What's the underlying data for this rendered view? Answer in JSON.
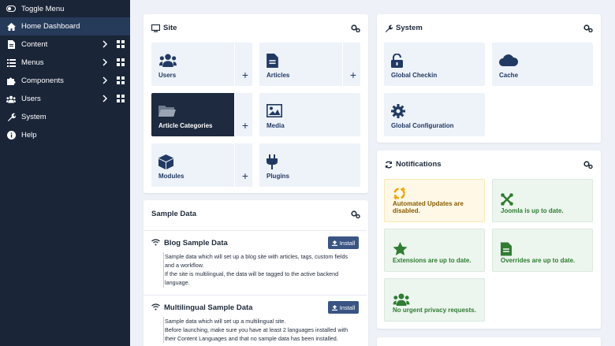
{
  "sidebar": {
    "toggle": "Toggle Menu",
    "items": [
      {
        "label": "Home Dashboard",
        "icon": "home-icon"
      },
      {
        "label": "Content",
        "icon": "file-icon"
      },
      {
        "label": "Menus",
        "icon": "list-icon"
      },
      {
        "label": "Components",
        "icon": "puzzle-icon"
      },
      {
        "label": "Users",
        "icon": "users-icon"
      },
      {
        "label": "System",
        "icon": "wrench-icon"
      },
      {
        "label": "Help",
        "icon": "info-icon"
      }
    ]
  },
  "site": {
    "title": "Site",
    "tiles": [
      {
        "label": "Users",
        "icon": "users-icon",
        "plus": "+"
      },
      {
        "label": "Articles",
        "icon": "file-icon",
        "plus": "+"
      },
      {
        "label": "Article Categories",
        "icon": "folder-icon",
        "plus": "+"
      },
      {
        "label": "Media",
        "icon": "image-icon"
      },
      {
        "label": "Modules",
        "icon": "cube-icon",
        "plus": "+"
      },
      {
        "label": "Plugins",
        "icon": "plug-icon"
      }
    ]
  },
  "system": {
    "title": "System",
    "tiles": [
      {
        "label": "Global Checkin",
        "icon": "unlock-icon"
      },
      {
        "label": "Cache",
        "icon": "cloud-icon"
      },
      {
        "label": "Global Configuration",
        "icon": "cog-icon"
      }
    ]
  },
  "notifications": {
    "title": "Notifications",
    "tiles": [
      {
        "label_line1": "Automated Updates are",
        "label_line2": "disabled.",
        "icon": "sync-warning-icon",
        "status": "warning"
      },
      {
        "label": "Joomla is up to date.",
        "icon": "joomla-icon",
        "status": "ok"
      },
      {
        "label": "Extensions are up to date.",
        "icon": "star-icon",
        "status": "ok"
      },
      {
        "label": "Overrides are up to date.",
        "icon": "file-icon",
        "status": "ok"
      },
      {
        "label": "No urgent privacy requests.",
        "icon": "users-icon",
        "status": "ok"
      }
    ]
  },
  "sample_data": {
    "title": "Sample Data",
    "items": [
      {
        "title": "Blog Sample Data",
        "install": "Install",
        "desc": [
          "Sample data which will set up a blog site with articles, tags, custom fields",
          "and a workflow.",
          "If the site is multilingual, the data will be tagged to the active backend",
          "language."
        ]
      },
      {
        "title": "Multilingual Sample Data",
        "install": "Install",
        "desc": [
          "Sample data which will set up a multilingual site.",
          "Before launching, make sure you have at least 2 languages installed with",
          "their Content Languages and that no sample data has been installed."
        ]
      }
    ]
  },
  "colors": {
    "sidebar_bg": "#1a2538",
    "sidebar_active": "#263a5a",
    "accent": "#213a63",
    "ok_green": "#2f7d32",
    "warning_orange": "#f0a500"
  }
}
